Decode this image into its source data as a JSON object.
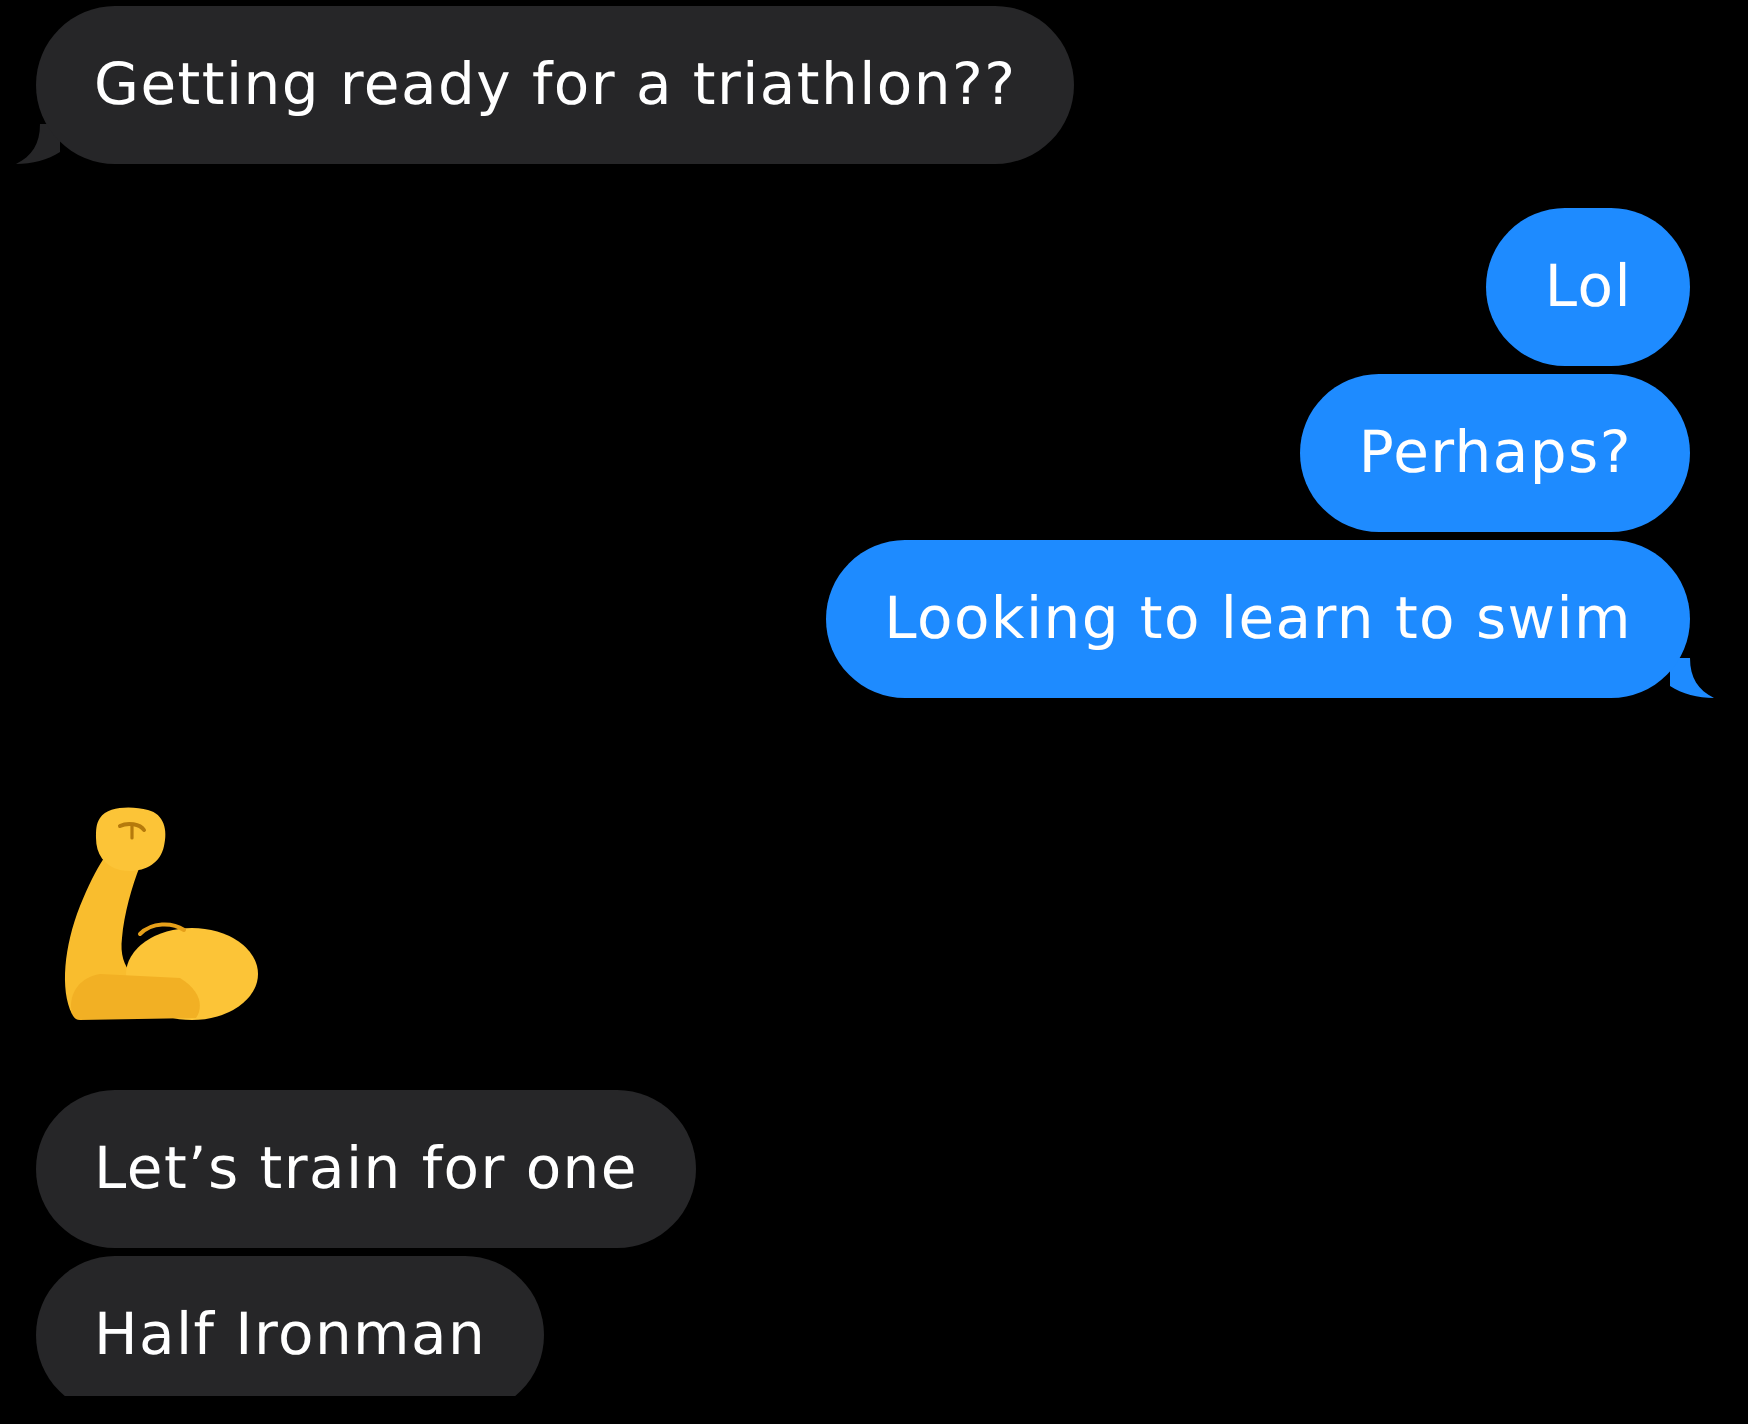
{
  "messages": [
    {
      "kind": "text",
      "outgoing": false,
      "text": "Getting ready for a triathlon??",
      "tail": true
    },
    {
      "kind": "text",
      "outgoing": true,
      "text": "Lol",
      "tail": false
    },
    {
      "kind": "text",
      "outgoing": true,
      "text": "Perhaps?",
      "tail": false
    },
    {
      "kind": "text",
      "outgoing": true,
      "text": "Looking to learn to swim",
      "tail": true
    },
    {
      "kind": "emoji",
      "outgoing": false
    },
    {
      "kind": "text",
      "outgoing": false,
      "text": "Let’s train for one",
      "tail": false
    },
    {
      "kind": "text",
      "outgoing": false,
      "text": "Half Ironman",
      "tail": false
    }
  ]
}
